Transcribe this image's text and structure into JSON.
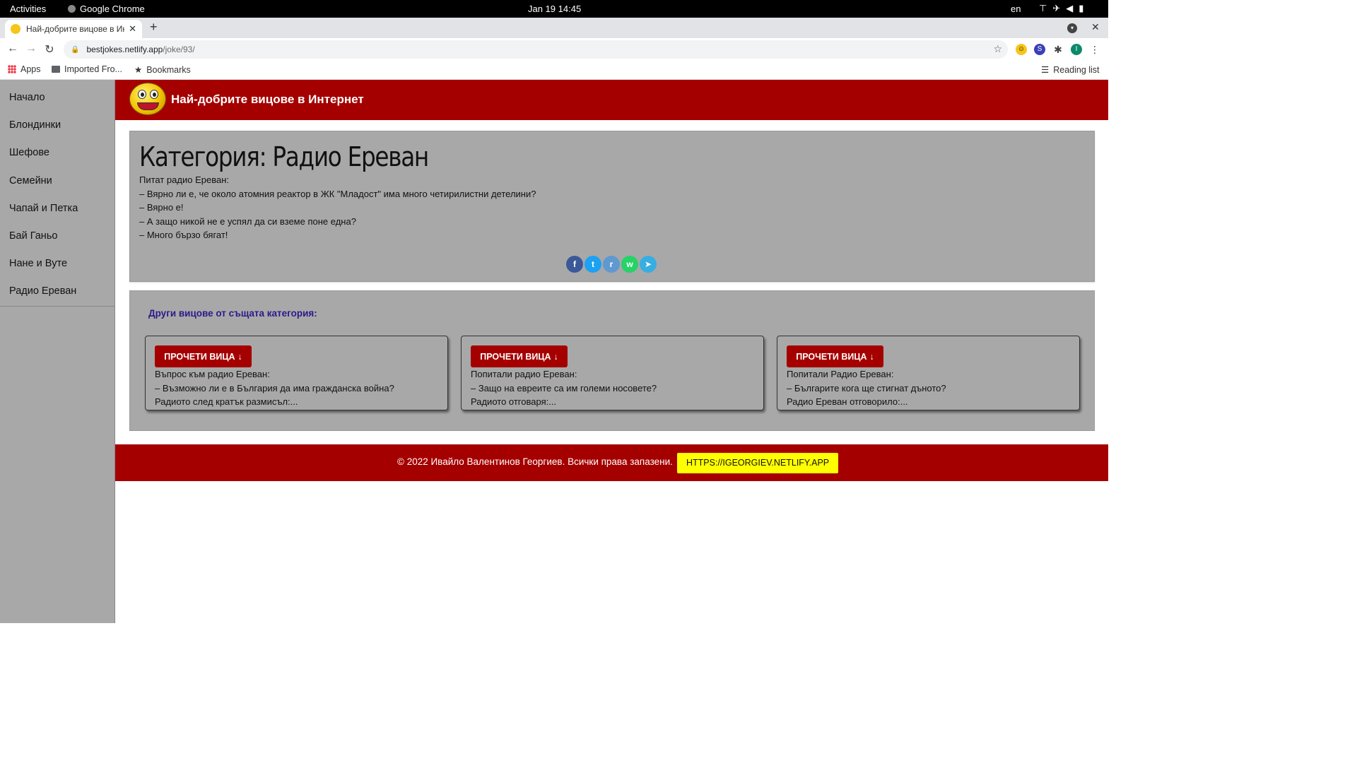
{
  "os": {
    "activities": "Activities",
    "app_name": "Google Chrome",
    "clock": "Jan 19  14:45",
    "lang": "en"
  },
  "browser": {
    "tab_title": "Най-добрите вицове в Интернет",
    "url_host": "bestjokes.netlify.app",
    "url_path": "/joke/93/",
    "bookmarks": {
      "apps": "Apps",
      "imported": "Imported Fro...",
      "bookmarks": "Bookmarks",
      "reading_list": "Reading list"
    },
    "profile_initial": "I"
  },
  "site": {
    "title": "Най-добрите вицове в Интернет",
    "nav": [
      "Начало",
      "Блондинки",
      "Шефове",
      "Семейни",
      "Чапай и Петка",
      "Бай Ганьо",
      "Нане и Вуте",
      "Радио Ереван"
    ],
    "joke": {
      "heading": "Категория: Радио Ереван",
      "lines": [
        "Питат радио Ереван:",
        "– Вярно ли е, че около атомния реактор в ЖК \"Младост\" има много четирилистни детелини?",
        "– Вярно е!",
        "– А защо никой не е успял да си вземе поне една?",
        "– Много бързо бягат!"
      ]
    },
    "share_icons": [
      "facebook-icon",
      "twitter-icon",
      "reddit-icon",
      "whatsapp-icon",
      "telegram-icon"
    ],
    "related": {
      "title": "Други вицове от същата категория:",
      "button_label": "ПРОЧЕТИ ВИЦА",
      "cards": [
        {
          "lines": [
            "Въпрос към радио Ереван:",
            "– Възможно ли е в България да има гражданска война?",
            "Радиото след кратък размисъл:..."
          ]
        },
        {
          "lines": [
            "Попитали радио Ереван:",
            "– Защо на евреите са им големи носовете?",
            "Радиото отговаря:..."
          ]
        },
        {
          "lines": [
            "Попитали Радио Ереван:",
            "– Българите кога ще стигнат дъното?",
            "Радио Ереван отговорило:..."
          ]
        }
      ]
    },
    "footer": {
      "copyright": "© 2022 Ивайло Валентинов Георгиев. Всички права запазени.",
      "link": "HTTPS://IGEORGIEV.NETLIFY.APP"
    }
  },
  "colors": {
    "brand_red": "#a50000",
    "panel_gray": "#a8a8a8",
    "link_yellow": "#ffff00",
    "related_title": "#2b1a8c"
  }
}
